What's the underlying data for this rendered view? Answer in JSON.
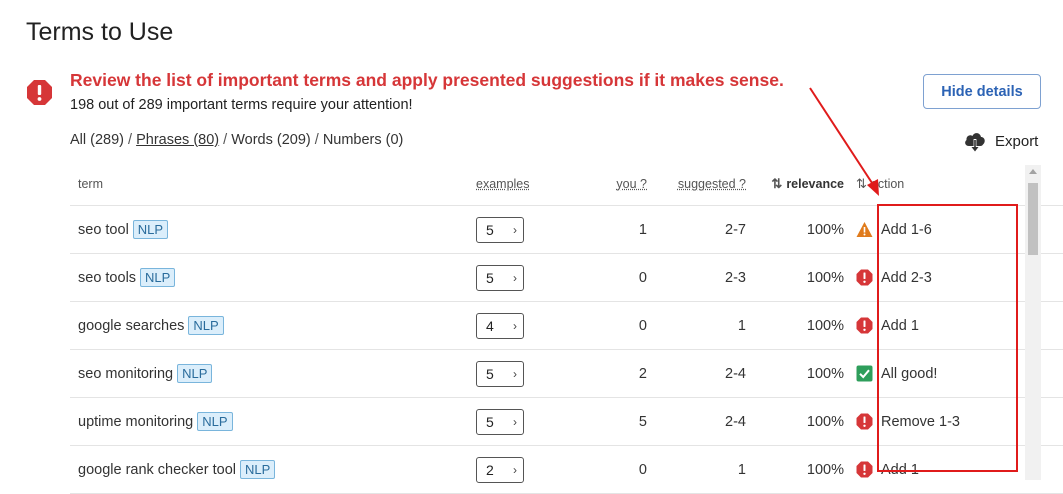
{
  "page": {
    "title": "Terms to Use"
  },
  "alert": {
    "title": "Review the list of important terms and apply presented suggestions if it makes sense.",
    "subtitle": "198 out of 289 important terms require your attention!"
  },
  "hide_button": {
    "label": "Hide details"
  },
  "filters": {
    "all": "All (289)",
    "phrases": "Phrases (80)",
    "words": "Words (209)",
    "numbers": "Numbers (0)",
    "separator": " / "
  },
  "export": {
    "label": "Export"
  },
  "table": {
    "headers": {
      "term": "term",
      "examples": "examples",
      "you": "you ?",
      "suggested": "suggested ?",
      "relevance": "relevance",
      "action": "action"
    },
    "tag_label": "NLP",
    "rows": [
      {
        "term": "seo tool",
        "examples": "5",
        "you": "1",
        "suggested": "2-7",
        "relevance": "100%",
        "action": "Add 1-6",
        "status": "warning"
      },
      {
        "term": "seo tools",
        "examples": "5",
        "you": "0",
        "suggested": "2-3",
        "relevance": "100%",
        "action": "Add 2-3",
        "status": "error"
      },
      {
        "term": "google searches",
        "examples": "4",
        "you": "0",
        "suggested": "1",
        "relevance": "100%",
        "action": "Add 1",
        "status": "error"
      },
      {
        "term": "seo monitoring",
        "examples": "5",
        "you": "2",
        "suggested": "2-4",
        "relevance": "100%",
        "action": "All good!",
        "status": "ok"
      },
      {
        "term": "uptime monitoring",
        "examples": "5",
        "you": "5",
        "suggested": "2-4",
        "relevance": "100%",
        "action": "Remove 1-3",
        "status": "error"
      },
      {
        "term": "google rank checker tool",
        "examples": "2",
        "you": "0",
        "suggested": "1",
        "relevance": "100%",
        "action": "Add 1",
        "status": "error"
      }
    ]
  },
  "colors": {
    "error": "#d63638",
    "warning": "#e07b1c",
    "ok": "#2e9e5b",
    "accent": "#2c63b5",
    "annotation": "#e01b1b"
  },
  "icons": {
    "alert": "exclamation-circle-icon",
    "export": "cloud-download-icon",
    "warning": "warning-triangle-icon",
    "error": "error-circle-icon",
    "ok": "check-square-icon",
    "sort": "sort-arrows-icon",
    "chevron": "chevron-right-icon"
  }
}
